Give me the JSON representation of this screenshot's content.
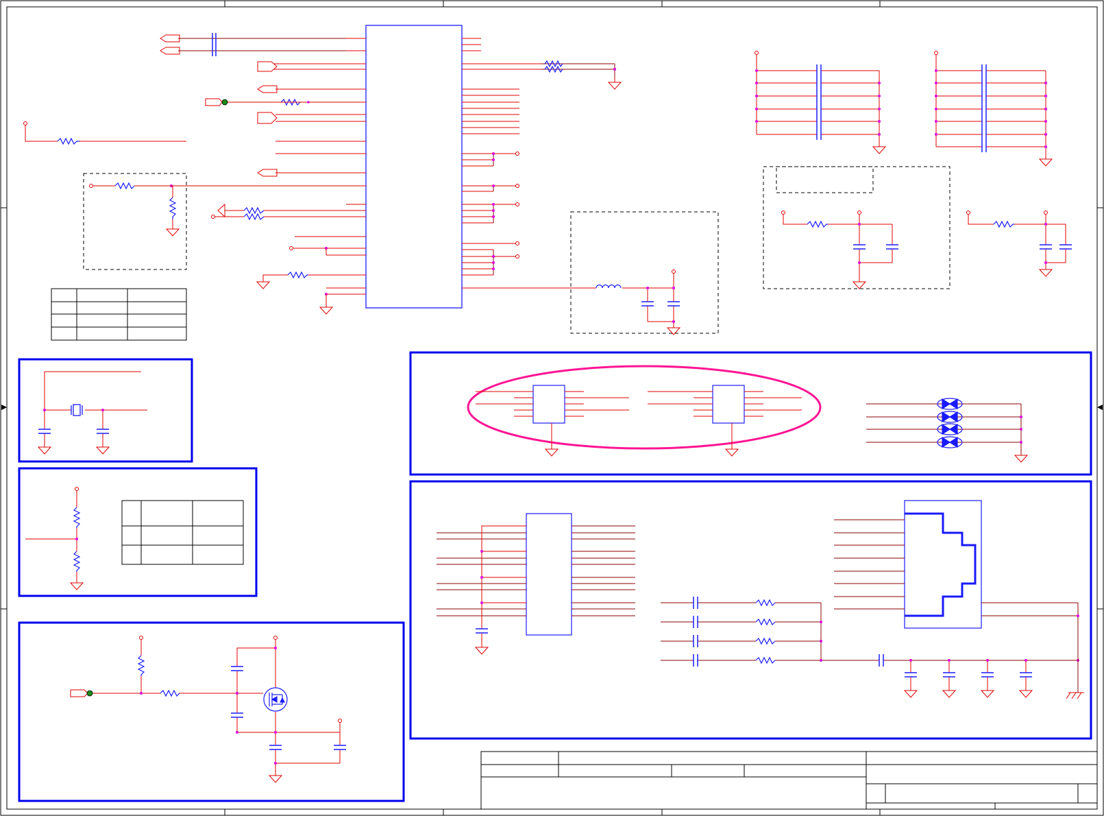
{
  "colors": {
    "wire": "#e00000",
    "net": "#8b0000",
    "component": "#1a1aff",
    "block": "#0000ee",
    "frame": "#000000",
    "highlight": "#ff1493",
    "junction": "#dd00dd",
    "connector_dot": "#1a8a1a"
  },
  "blocks": [
    {
      "id": "crystal-block"
    },
    {
      "id": "bootstrap-block"
    },
    {
      "id": "power-switch-block"
    },
    {
      "id": "usb-protection-block"
    },
    {
      "id": "ethernet-magnetics-block"
    }
  ],
  "tables": [
    {
      "id": "straps-table-top",
      "rows": 4,
      "cols": 3
    },
    {
      "id": "straps-table-bottom",
      "rows": 3,
      "cols": 3
    },
    {
      "id": "title-block",
      "rows": 3,
      "cols": 4
    }
  ]
}
